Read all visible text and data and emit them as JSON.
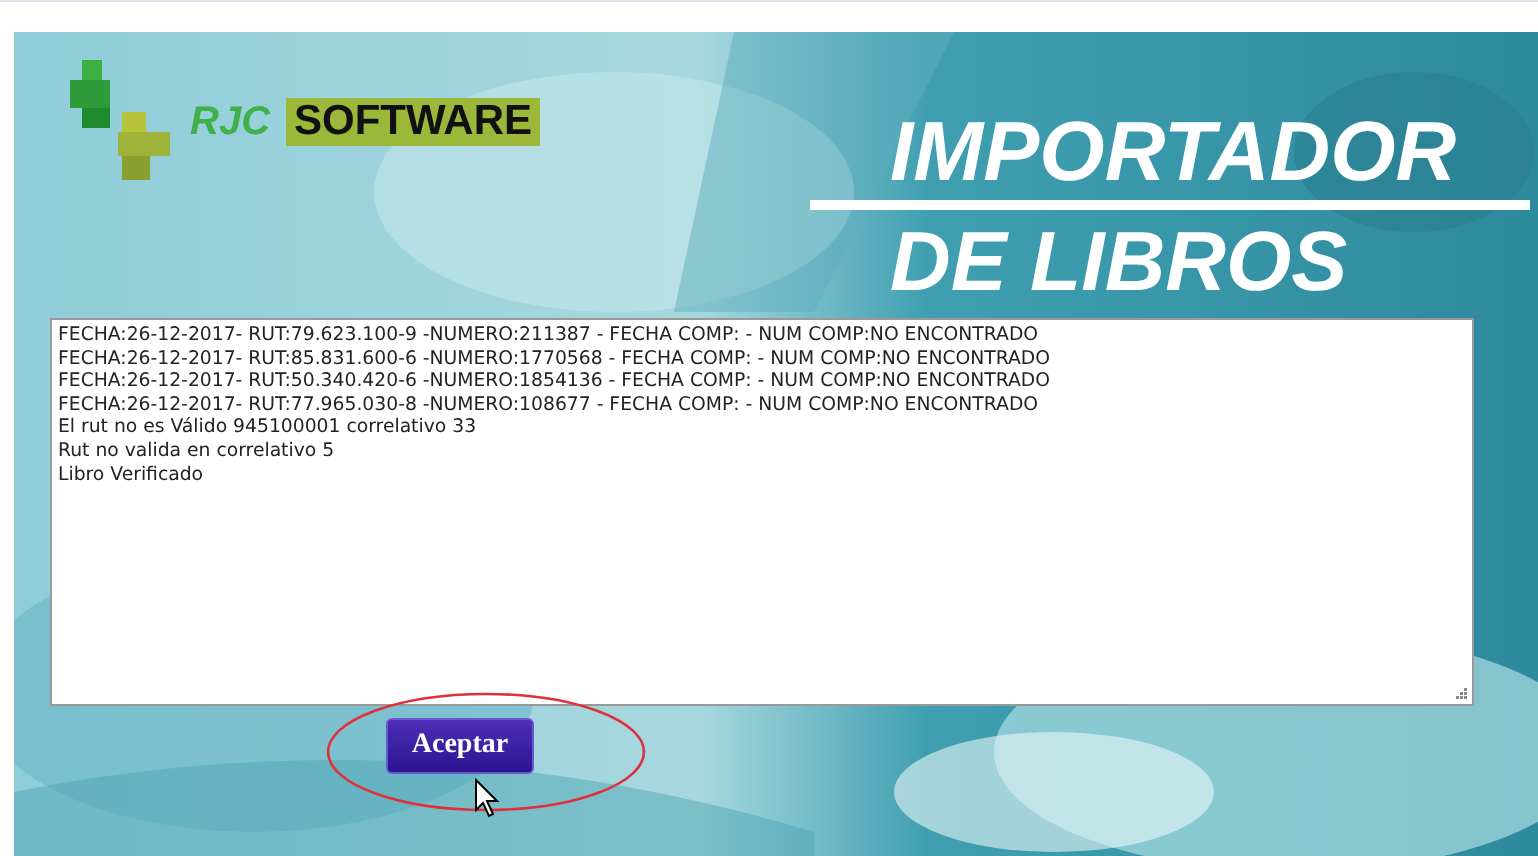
{
  "logo": {
    "prefix": "RJC",
    "name": "SOFTWARE"
  },
  "title": [
    "IMPORTADOR",
    "DE LIBROS"
  ],
  "log": [
    "FECHA:26-12-2017- RUT:79.623.100-9 -NUMERO:211387 - FECHA COMP: - NUM COMP:NO ENCONTRADO",
    "FECHA:26-12-2017- RUT:85.831.600-6 -NUMERO:1770568 - FECHA COMP: - NUM COMP:NO ENCONTRADO",
    "FECHA:26-12-2017- RUT:50.340.420-6 -NUMERO:1854136 - FECHA COMP: - NUM COMP:NO ENCONTRADO",
    "FECHA:26-12-2017- RUT:77.965.030-8 -NUMERO:108677 - FECHA COMP: - NUM COMP:NO ENCONTRADO",
    "El rut no es Válido 945100001 correlativo 33",
    "Rut no valida en correlativo 5",
    "Libro Verificado"
  ],
  "button": "Aceptar"
}
